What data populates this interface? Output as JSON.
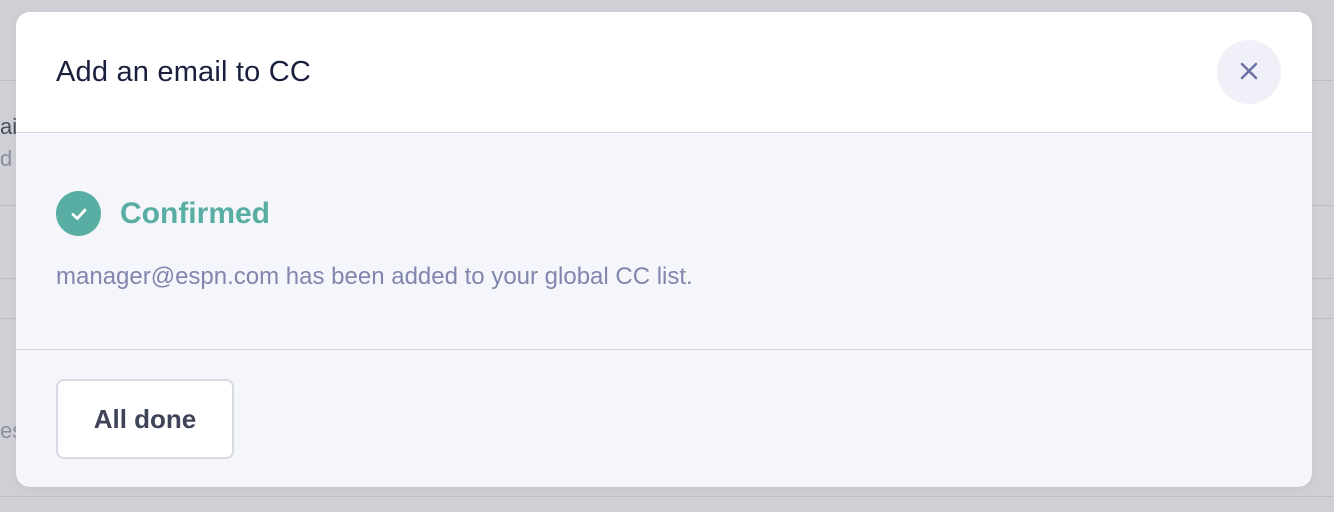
{
  "background": {
    "fragments": [
      "ail",
      "d",
      "es"
    ]
  },
  "modal": {
    "title": "Add an email to CC",
    "close_icon": "close-icon",
    "status": {
      "icon": "check-circle-icon",
      "label": "Confirmed",
      "color": "#58aea2"
    },
    "message": "manager@espn.com has been added to your global CC list.",
    "footer": {
      "done_label": "All done"
    }
  }
}
